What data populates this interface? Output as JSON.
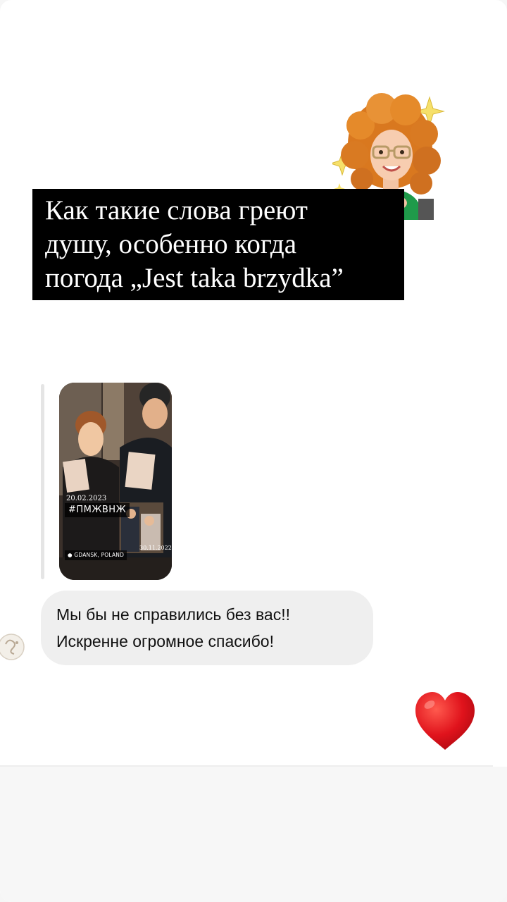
{
  "story": {
    "caption_lines": [
      "Как такие слова греют",
      "душу, особенно когда",
      "погода „Jest taka brzydka”"
    ],
    "sticker": "memoji-sparkles"
  },
  "dm": {
    "shared_story": {
      "date_1": "20.02.2023",
      "hashtag": "#ПМЖВНЖ",
      "date_2": "30.11.2022",
      "location": "GDANSK, POLAND"
    },
    "message_lines": [
      "Мы бы не справились без вас!!",
      "Искренне огромное спасибо!"
    ],
    "reaction": "red-heart",
    "colors": {
      "bubble": "#efefef",
      "caption_bg": "#000000",
      "heart": "#e0131c"
    }
  }
}
